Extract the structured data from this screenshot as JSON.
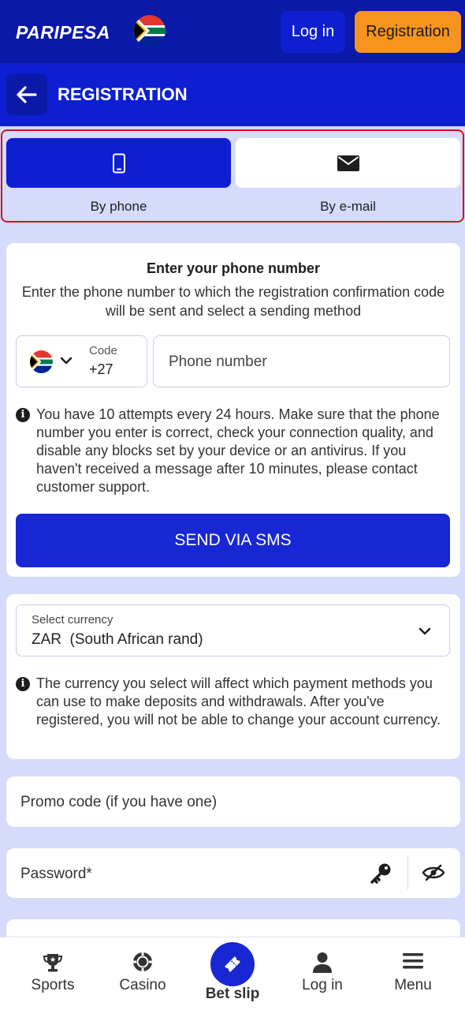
{
  "header": {
    "logo": "PARIPESA",
    "login_label": "Log in",
    "register_label": "Registration"
  },
  "subheader": {
    "title": "REGISTRATION"
  },
  "tabs": [
    {
      "label": "By phone",
      "icon": "mobile-phone-icon",
      "active": true
    },
    {
      "label": "By e-mail",
      "icon": "envelope-icon",
      "active": false
    }
  ],
  "phone_section": {
    "title": "Enter your phone number",
    "description": "Enter the phone number to which the registration confirmation code will be sent and select a sending method",
    "code_label": "Code",
    "code_value": "+27",
    "phone_placeholder": "Phone number",
    "info_text": "You have 10 attempts every 24 hours. Make sure that the phone number you enter is correct, check your connection quality, and disable any blocks set by your device or an antivirus. If you haven't received a message after 10 minutes, please contact customer support.",
    "send_button": "SEND VIA SMS"
  },
  "currency_section": {
    "label": "Select currency",
    "value": "ZAR  (South African rand)",
    "info_text": "The currency you select will affect which payment methods you can use to make deposits and withdrawals. After you've registered, you will not be able to change your account currency."
  },
  "promo": {
    "placeholder": "Promo code (if you have one)"
  },
  "password": {
    "placeholder": "Password*"
  },
  "bottom_nav": [
    {
      "label": "Sports",
      "icon": "trophy-icon"
    },
    {
      "label": "Casino",
      "icon": "casino-chip-icon"
    },
    {
      "label": "Bet slip",
      "icon": "ticket-icon"
    },
    {
      "label": "Log in",
      "icon": "user-icon"
    },
    {
      "label": "Menu",
      "icon": "hamburger-menu-icon"
    }
  ],
  "colors": {
    "header_bg": "#0a19a8",
    "subheader_bg": "#0d1fd0",
    "accent_orange": "#f7941d",
    "primary_button": "#1827d4",
    "page_bg": "#d6dafb",
    "highlight_border": "#d0121b"
  }
}
